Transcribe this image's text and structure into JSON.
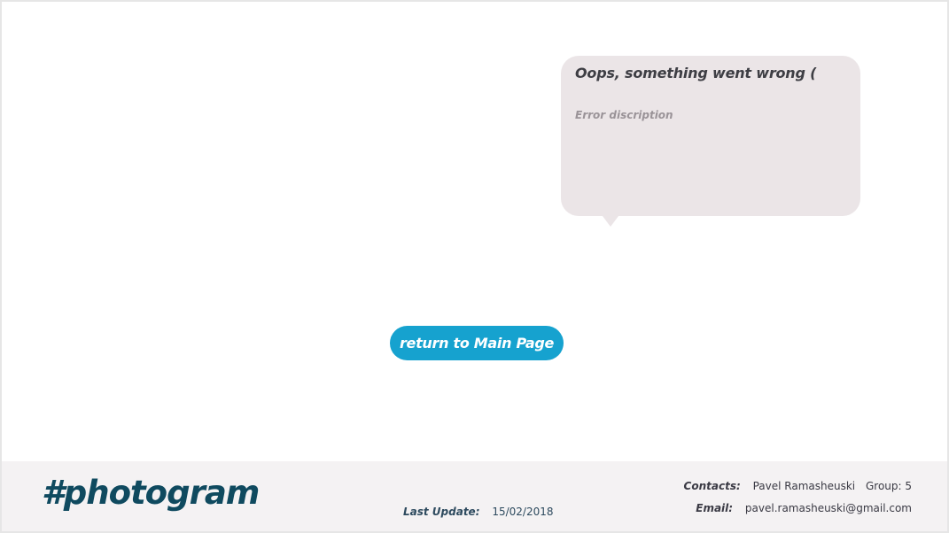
{
  "error": {
    "title": "Oops, something went wrong (",
    "description": "Error discription"
  },
  "actions": {
    "return_label": "return to Main Page"
  },
  "footer": {
    "logo": "#photogram",
    "last_update_label": "Last Update:",
    "last_update_value": "15/02/2018",
    "contacts_label": "Contacts:",
    "contacts_name": "Pavel Ramasheuski",
    "group": "Group: 5",
    "email_label": "Email:",
    "email_value": "pavel.ramasheuski@gmail.com"
  },
  "colors": {
    "accent": "#16a2cf",
    "logo": "#0f4a5f",
    "bubble": "#ebe5e7",
    "footer_bg": "#f4f2f3"
  }
}
